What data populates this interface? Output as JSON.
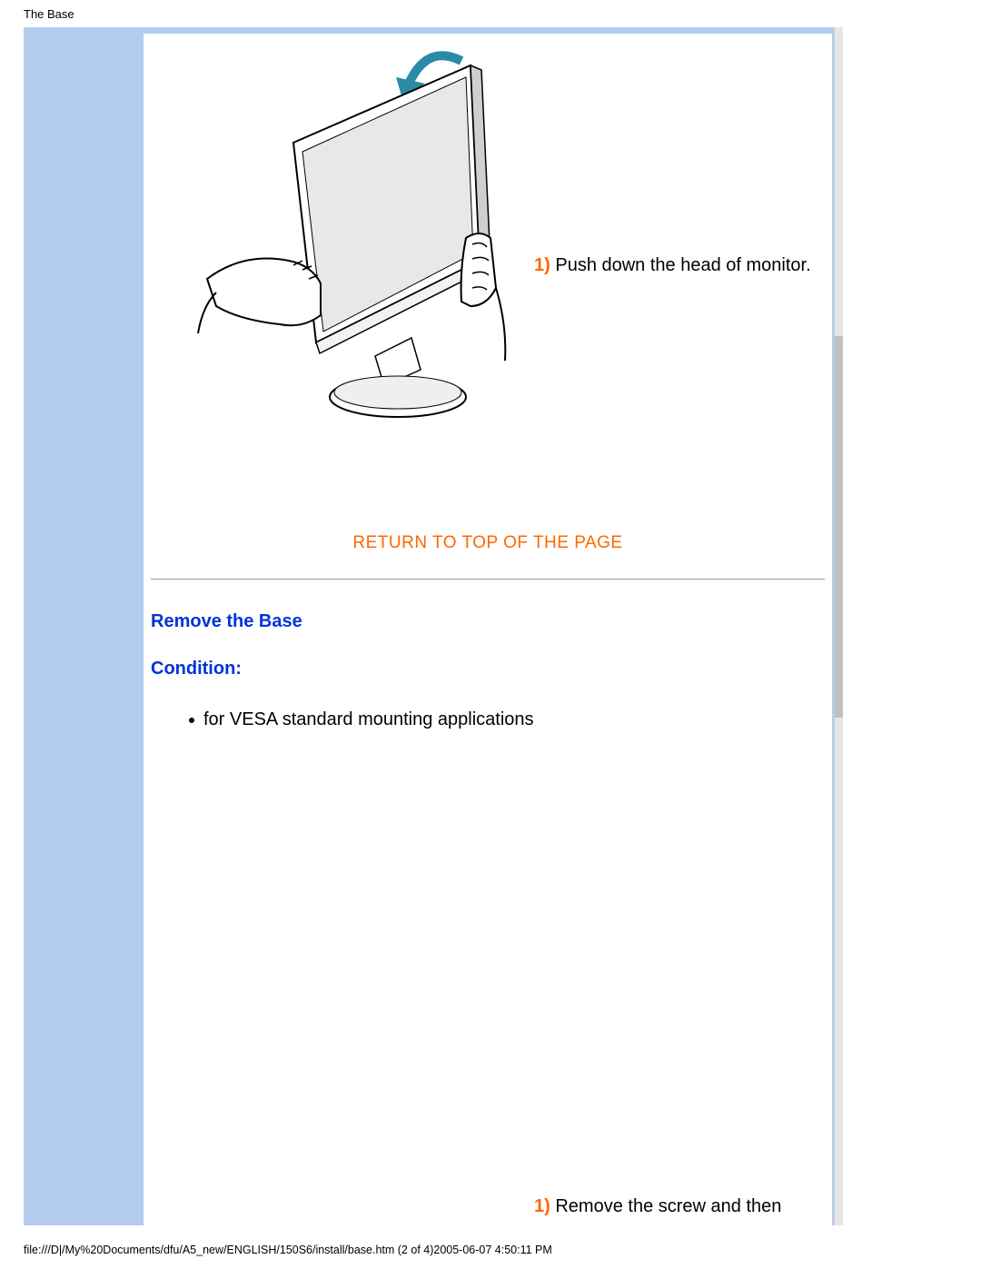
{
  "header": {
    "title": "The Base"
  },
  "step1": {
    "num": "1)",
    "text": " Push down the head of monitor."
  },
  "return_link": "RETURN TO TOP OF THE PAGE",
  "section": {
    "title": "Remove the Base",
    "condition_label": "Condition:",
    "bullet": "for VESA standard mounting applications"
  },
  "step1b": {
    "num": "1)",
    "text": " Remove the screw and then"
  },
  "footer": "file:///D|/My%20Documents/dfu/A5_new/ENGLISH/150S6/install/base.htm (2 of 4)2005-06-07 4:50:11 PM"
}
